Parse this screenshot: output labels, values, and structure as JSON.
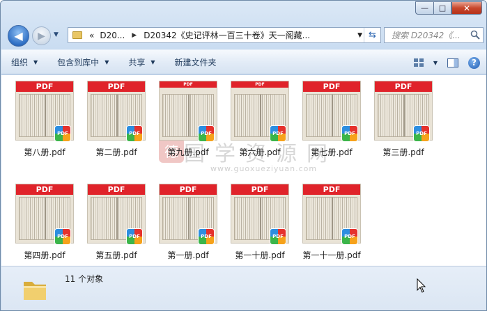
{
  "window": {
    "minimize_glyph": "—",
    "maximize_glyph": "□",
    "close_glyph": "✕"
  },
  "nav": {
    "back_glyph": "◀",
    "forward_glyph": "▶"
  },
  "address": {
    "overflow": "«",
    "crumb1": "D20...",
    "crumb2": "D20342《史记评林一百三十卷》天一阁藏..."
  },
  "search": {
    "placeholder": "搜索 D20342《..."
  },
  "toolbar": {
    "organize": "组织",
    "include_in_library": "包含到库中",
    "share": "共享",
    "new_folder": "新建文件夹",
    "help_glyph": "?"
  },
  "files": [
    {
      "name": "第八册.pdf",
      "band": "PDF"
    },
    {
      "name": "第二册.pdf",
      "band": "PDF"
    },
    {
      "name": "第九册.pdf",
      "band": "PDF"
    },
    {
      "name": "第六册.pdf",
      "band": "PDF"
    },
    {
      "name": "第七册.pdf",
      "band": "PDF"
    },
    {
      "name": "第三册.pdf",
      "band": "PDF"
    },
    {
      "name": "第四册.pdf",
      "band": "PDF"
    },
    {
      "name": "第五册.pdf",
      "band": "PDF"
    },
    {
      "name": "第一册.pdf",
      "band": "PDF"
    },
    {
      "name": "第一十册.pdf",
      "band": "PDF"
    },
    {
      "name": "第一十一册.pdf",
      "band": "PDF"
    }
  ],
  "badge_label": "PDF",
  "watermark": {
    "text": "国学资源网",
    "url": "www.guoxueziyuan.com"
  },
  "status": {
    "item_count": "11 个对象"
  },
  "colors": {
    "pdf_band": "#e0232a",
    "accent": "#2f6fc4"
  }
}
